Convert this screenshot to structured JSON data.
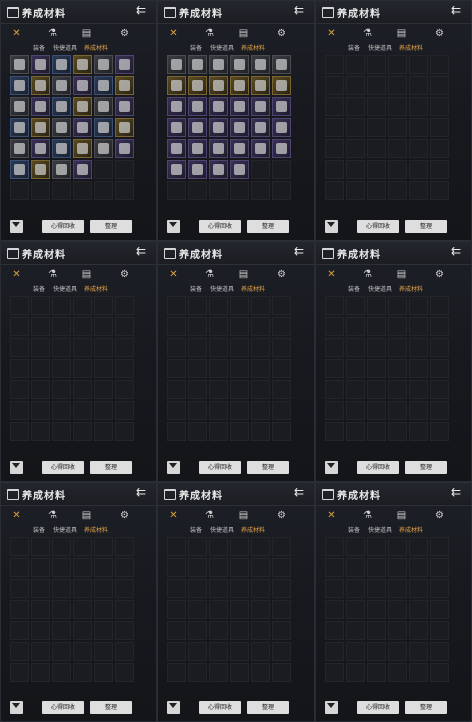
{
  "panels": [
    {
      "id": "p1",
      "title": "养成材料",
      "tabs": [
        "装备",
        "快捷道具",
        "养成材料"
      ],
      "active_tab": 2,
      "buttons": {
        "recycle": "心得回收",
        "sort": "整理"
      },
      "items_filled": 34,
      "pattern": "mixed"
    },
    {
      "id": "p2",
      "title": "养成材料",
      "tabs": [
        "装备",
        "快捷道具",
        "养成材料"
      ],
      "active_tab": 2,
      "buttons": {
        "recycle": "心得回收",
        "sort": "整理"
      },
      "items_filled": 34,
      "pattern": "purple-gold"
    },
    {
      "id": "p3",
      "title": "养成材料",
      "tabs": [
        "装备",
        "快捷道具",
        "养成材料"
      ],
      "active_tab": 2,
      "buttons": {
        "recycle": "心得回收",
        "sort": "整理"
      },
      "items_filled": 0,
      "pattern": "empty"
    },
    {
      "id": "p4",
      "title": "养成材料",
      "tabs": [
        "装备",
        "快捷道具",
        "养成材料"
      ],
      "active_tab": 2,
      "buttons": {
        "recycle": "心得回收",
        "sort": "整理"
      },
      "items_filled": 0,
      "pattern": "empty"
    },
    {
      "id": "p5",
      "title": "养成材料",
      "tabs": [
        "装备",
        "快捷道具",
        "养成材料"
      ],
      "active_tab": 2,
      "buttons": {
        "recycle": "心得回收",
        "sort": "整理"
      },
      "items_filled": 0,
      "pattern": "empty"
    },
    {
      "id": "p6",
      "title": "养成材料",
      "tabs": [
        "装备",
        "快捷道具",
        "养成材料"
      ],
      "active_tab": 2,
      "buttons": {
        "recycle": "心得回收",
        "sort": "整理"
      },
      "items_filled": 0,
      "pattern": "empty"
    },
    {
      "id": "p7",
      "title": "养成材料",
      "tabs": [
        "装备",
        "快捷道具",
        "养成材料"
      ],
      "active_tab": 2,
      "buttons": {
        "recycle": "心得回收",
        "sort": "整理"
      },
      "items_filled": 0,
      "pattern": "empty"
    },
    {
      "id": "p8",
      "title": "养成材料",
      "tabs": [
        "装备",
        "快捷道具",
        "养成材料"
      ],
      "active_tab": 2,
      "buttons": {
        "recycle": "心得回收",
        "sort": "整理"
      },
      "items_filled": 0,
      "pattern": "empty"
    },
    {
      "id": "p9",
      "title": "养成材料",
      "tabs": [
        "装备",
        "快捷道具",
        "养成材料"
      ],
      "active_tab": 2,
      "buttons": {
        "recycle": "心得回收",
        "sort": "整理"
      },
      "items_filled": 0,
      "pattern": "empty"
    }
  ],
  "icons": {
    "bag": "bag-icon",
    "collapse": "double-chevron-left-icon",
    "close": "close-icon",
    "equipment": "equipment-icon",
    "quick_item": "quick-item-icon",
    "material": "material-icon",
    "filter": "filter-icon"
  },
  "colors": {
    "active_tab": "#e4a34a",
    "close_icon": "#d9a13b",
    "button_bg": "#dedede",
    "panel_bg": "#17191e"
  }
}
